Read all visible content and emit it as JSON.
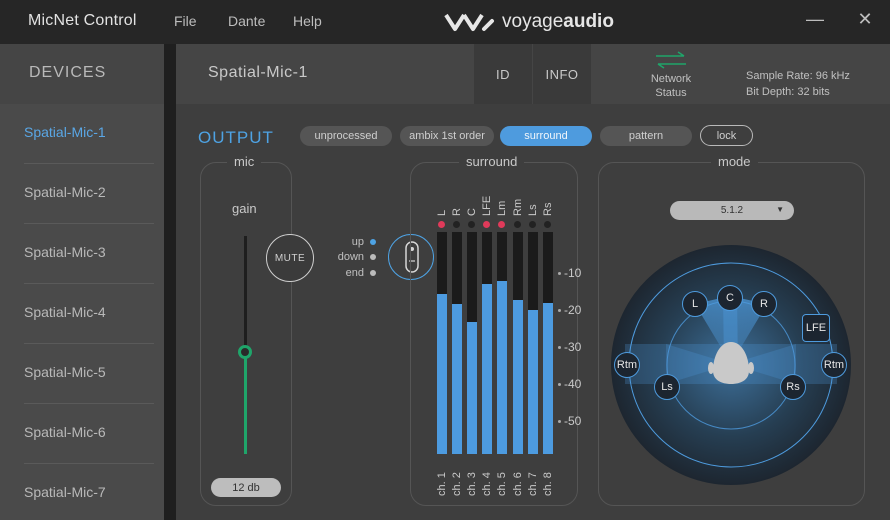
{
  "app": {
    "title": "MicNet Control"
  },
  "menu": [
    {
      "label": "File"
    },
    {
      "label": "Dante"
    },
    {
      "label": "Help"
    }
  ],
  "logo": {
    "text_a": "voyage",
    "text_b": "audio"
  },
  "window": {
    "minimize": "—",
    "close": "✕"
  },
  "sidebar": {
    "title": "DEVICES",
    "devices": [
      {
        "label": "Spatial-Mic-1"
      },
      {
        "label": "Spatial-Mic-2"
      },
      {
        "label": "Spatial-Mic-3"
      },
      {
        "label": "Spatial-Mic-4"
      },
      {
        "label": "Spatial-Mic-5"
      },
      {
        "label": "Spatial-Mic-6"
      },
      {
        "label": "Spatial-Mic-7"
      }
    ],
    "active_index": 0
  },
  "header": {
    "device_name": "Spatial-Mic-1",
    "id_button": "ID",
    "info_button": "INFO",
    "network_label": "Network",
    "network_status": "Status",
    "sample_rate": "Sample Rate: 96 kHz",
    "bit_depth": "Bit Depth: 32 bits"
  },
  "output": {
    "title": "OUTPUT",
    "modes": [
      {
        "label": "unprocessed",
        "active": false
      },
      {
        "label": "ambix 1st order",
        "active": false
      },
      {
        "label": "surround",
        "active": true
      },
      {
        "label": "pattern",
        "active": false
      }
    ],
    "lock_label": "lock"
  },
  "mic_panel": {
    "title": "mic",
    "gain_label": "gain",
    "mute_label": "MUTE",
    "gain_value": "12 db",
    "gain_fraction": 0.47
  },
  "orientation": {
    "options": [
      {
        "label": "up",
        "selected": true
      },
      {
        "label": "down",
        "selected": false
      },
      {
        "label": "end",
        "selected": false
      }
    ]
  },
  "surround_panel": {
    "title": "surround",
    "channels": [
      {
        "name": "L",
        "label": "ch. 1",
        "clip": true,
        "level": 0.72
      },
      {
        "name": "R",
        "label": "ch. 2",
        "clip": false,
        "level": 0.675
      },
      {
        "name": "C",
        "label": "ch. 3",
        "clip": false,
        "level": 0.595
      },
      {
        "name": "LFE",
        "label": "ch. 4",
        "clip": true,
        "level": 0.765
      },
      {
        "name": "Lm",
        "label": "ch. 5",
        "clip": true,
        "level": 0.78
      },
      {
        "name": "Rm",
        "label": "ch. 6",
        "clip": false,
        "level": 0.695
      },
      {
        "name": "Ls",
        "label": "ch. 7",
        "clip": false,
        "level": 0.65
      },
      {
        "name": "Rs",
        "label": "ch. 8",
        "clip": false,
        "level": 0.68
      }
    ],
    "scale": [
      "-10",
      "-20",
      "-30",
      "-40",
      "-50"
    ]
  },
  "mode_panel": {
    "title": "mode",
    "selected": "5.1.2",
    "speakers": [
      "L",
      "C",
      "R",
      "LFE",
      "Rtm",
      "Ls",
      "Rs",
      "Rtm"
    ]
  },
  "colors": {
    "accent": "#4e9bde",
    "green": "#1fa56a",
    "clip": "#e03a5a"
  }
}
